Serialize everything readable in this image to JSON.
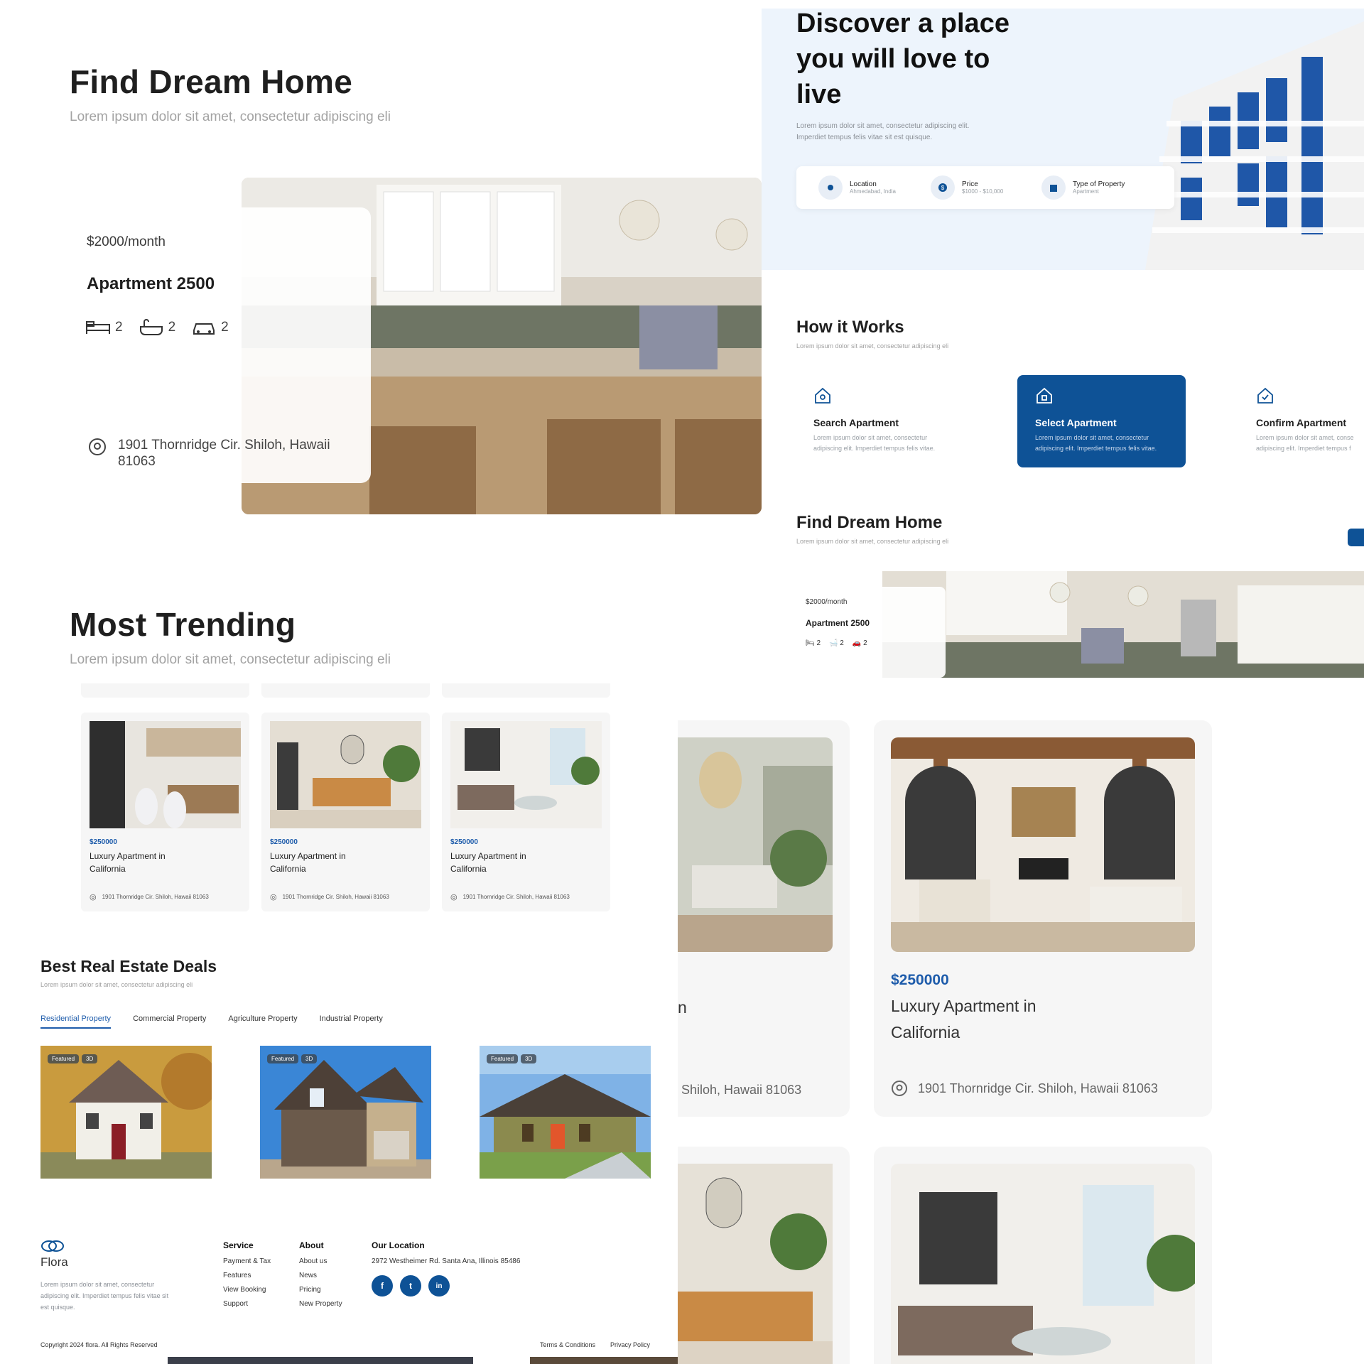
{
  "hero_left": {
    "title": "Find Dream Home",
    "subtitle": "Lorem ipsum dolor sit amet, consectetur adipiscing eli",
    "card": {
      "price": "$2000/month",
      "name": "Apartment 2500",
      "beds": "2",
      "baths": "2",
      "cars": "2",
      "address": "1901 Thornridge Cir. Shiloh, Hawaii 81063"
    }
  },
  "hero_right": {
    "title_line1": "Discover a place",
    "title_line2": "you will love to",
    "title_line3": "live",
    "desc_line1": "Lorem ipsum dolor sit amet, consectetur adipiscing elit.",
    "desc_line2": "Imperdiet tempus felis vitae sit est quisque.",
    "search": {
      "location_label": "Location",
      "location_value": "Ahmedabad, India",
      "price_label": "Price",
      "price_value": "$1000 - $10,000",
      "type_label": "Type of Property",
      "type_value": "Apartment"
    }
  },
  "how_it_works": {
    "title": "How it Works",
    "subtitle": "Lorem ipsum dolor sit amet, consectetur adipiscing eli",
    "steps": [
      {
        "title": "Search Apartment",
        "desc1": "Lorem ipsum dolor sit amet, consectetur",
        "desc2": "adipiscing elit. Imperdiet tempus felis vitae."
      },
      {
        "title": "Select Apartment",
        "desc1": "Lorem ipsum dolor sit amet, consectetur",
        "desc2": "adipiscing elit. Imperdiet tempus felis vitae."
      },
      {
        "title": "Confirm Apartment",
        "desc1": "Lorem ipsum dolor sit amet, conse",
        "desc2": "adipiscing elit. Imperdiet tempus f"
      }
    ]
  },
  "find_dream_small": {
    "title": "Find Dream Home",
    "subtitle": "Lorem ipsum dolor sit amet, consectetur adipiscing eli",
    "price": "$2000/month",
    "name": "Apartment 2500",
    "beds": "2",
    "baths": "2",
    "cars": "2"
  },
  "trending": {
    "title": "Most Trending",
    "subtitle": "Lorem ipsum dolor sit amet, consectetur adipiscing eli",
    "cards": [
      {
        "price": "$250000",
        "name1": "Luxury Apartment in",
        "name2": "California",
        "address": "1901 Thornridge Cir. Shiloh, Hawaii 81063"
      },
      {
        "price": "$250000",
        "name1": "Luxury Apartment in",
        "name2": "California",
        "address": "1901 Thornridge Cir. Shiloh, Hawaii 81063"
      },
      {
        "price": "$250000",
        "name1": "Luxury Apartment in",
        "name2": "California",
        "address": "1901 Thornridge Cir. Shiloh, Hawaii 81063"
      }
    ]
  },
  "deals": {
    "title": "Best Real Estate Deals",
    "subtitle": "Lorem ipsum dolor sit amet, consectetur adipiscing eli",
    "tabs": [
      "Residential Property",
      "Commercial Property",
      "Agriculture Property",
      "Industrial Property"
    ],
    "badge_featured": "Featured",
    "badge_3d": "3D"
  },
  "footer": {
    "brand": "Flora",
    "about_line1": "Lorem ipsum dolor sit amet, consectetur",
    "about_line2": "adipiscing elit. Imperdiet tempus felis vitae sit",
    "about_line3": "est quisque.",
    "service_head": "Service",
    "service_links": [
      "Payment & Tax",
      "Features",
      "View Booking",
      "Support"
    ],
    "about_head": "About",
    "about_links": [
      "About us",
      "News",
      "Pricing",
      "New Property"
    ],
    "location_head": "Our Location",
    "location_addr": "2972 Westheimer Rd. Santa Ana, Illinois 85486",
    "social": [
      "f",
      "t",
      "in"
    ],
    "copyright": "Copyright 2024 flora. All Rights Reserved",
    "terms": "Terms & Conditions",
    "privacy": "Privacy Policy"
  },
  "large_cards": {
    "partial_name": "n",
    "partial_addr": "Shiloh, Hawaii 81063",
    "price": "$250000",
    "name1": "Luxury Apartment in",
    "name2": "California",
    "address": "1901 Thornridge Cir. Shiloh, Hawaii 81063"
  },
  "colors": {
    "accent": "#0e5296",
    "price_blue": "#1e5cab",
    "hero_bg": "#edf4fc"
  }
}
